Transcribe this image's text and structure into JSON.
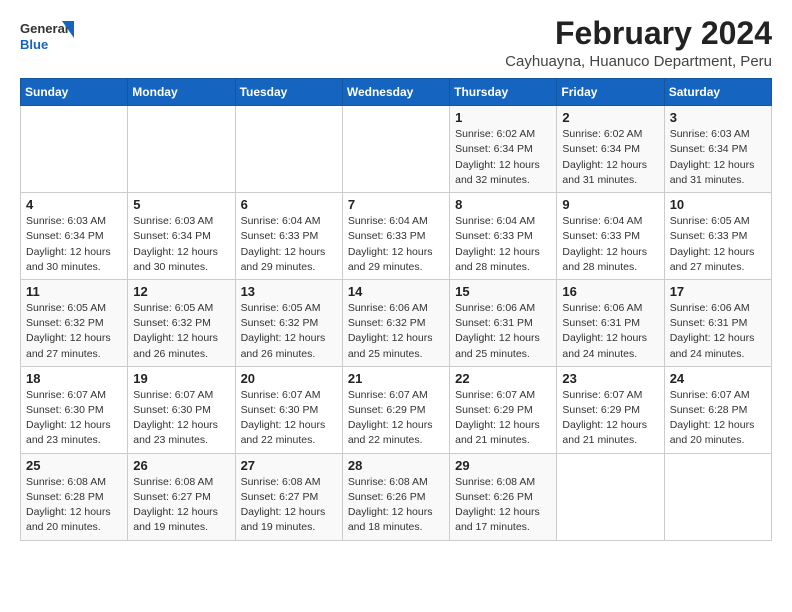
{
  "logo": {
    "general": "General",
    "blue": "Blue"
  },
  "title": "February 2024",
  "subtitle": "Cayhuayna, Huanuco Department, Peru",
  "columns": [
    "Sunday",
    "Monday",
    "Tuesday",
    "Wednesday",
    "Thursday",
    "Friday",
    "Saturday"
  ],
  "weeks": [
    [
      {
        "day": "",
        "detail": ""
      },
      {
        "day": "",
        "detail": ""
      },
      {
        "day": "",
        "detail": ""
      },
      {
        "day": "",
        "detail": ""
      },
      {
        "day": "1",
        "detail": "Sunrise: 6:02 AM\nSunset: 6:34 PM\nDaylight: 12 hours\nand 32 minutes."
      },
      {
        "day": "2",
        "detail": "Sunrise: 6:02 AM\nSunset: 6:34 PM\nDaylight: 12 hours\nand 31 minutes."
      },
      {
        "day": "3",
        "detail": "Sunrise: 6:03 AM\nSunset: 6:34 PM\nDaylight: 12 hours\nand 31 minutes."
      }
    ],
    [
      {
        "day": "4",
        "detail": "Sunrise: 6:03 AM\nSunset: 6:34 PM\nDaylight: 12 hours\nand 30 minutes."
      },
      {
        "day": "5",
        "detail": "Sunrise: 6:03 AM\nSunset: 6:34 PM\nDaylight: 12 hours\nand 30 minutes."
      },
      {
        "day": "6",
        "detail": "Sunrise: 6:04 AM\nSunset: 6:33 PM\nDaylight: 12 hours\nand 29 minutes."
      },
      {
        "day": "7",
        "detail": "Sunrise: 6:04 AM\nSunset: 6:33 PM\nDaylight: 12 hours\nand 29 minutes."
      },
      {
        "day": "8",
        "detail": "Sunrise: 6:04 AM\nSunset: 6:33 PM\nDaylight: 12 hours\nand 28 minutes."
      },
      {
        "day": "9",
        "detail": "Sunrise: 6:04 AM\nSunset: 6:33 PM\nDaylight: 12 hours\nand 28 minutes."
      },
      {
        "day": "10",
        "detail": "Sunrise: 6:05 AM\nSunset: 6:33 PM\nDaylight: 12 hours\nand 27 minutes."
      }
    ],
    [
      {
        "day": "11",
        "detail": "Sunrise: 6:05 AM\nSunset: 6:32 PM\nDaylight: 12 hours\nand 27 minutes."
      },
      {
        "day": "12",
        "detail": "Sunrise: 6:05 AM\nSunset: 6:32 PM\nDaylight: 12 hours\nand 26 minutes."
      },
      {
        "day": "13",
        "detail": "Sunrise: 6:05 AM\nSunset: 6:32 PM\nDaylight: 12 hours\nand 26 minutes."
      },
      {
        "day": "14",
        "detail": "Sunrise: 6:06 AM\nSunset: 6:32 PM\nDaylight: 12 hours\nand 25 minutes."
      },
      {
        "day": "15",
        "detail": "Sunrise: 6:06 AM\nSunset: 6:31 PM\nDaylight: 12 hours\nand 25 minutes."
      },
      {
        "day": "16",
        "detail": "Sunrise: 6:06 AM\nSunset: 6:31 PM\nDaylight: 12 hours\nand 24 minutes."
      },
      {
        "day": "17",
        "detail": "Sunrise: 6:06 AM\nSunset: 6:31 PM\nDaylight: 12 hours\nand 24 minutes."
      }
    ],
    [
      {
        "day": "18",
        "detail": "Sunrise: 6:07 AM\nSunset: 6:30 PM\nDaylight: 12 hours\nand 23 minutes."
      },
      {
        "day": "19",
        "detail": "Sunrise: 6:07 AM\nSunset: 6:30 PM\nDaylight: 12 hours\nand 23 minutes."
      },
      {
        "day": "20",
        "detail": "Sunrise: 6:07 AM\nSunset: 6:30 PM\nDaylight: 12 hours\nand 22 minutes."
      },
      {
        "day": "21",
        "detail": "Sunrise: 6:07 AM\nSunset: 6:29 PM\nDaylight: 12 hours\nand 22 minutes."
      },
      {
        "day": "22",
        "detail": "Sunrise: 6:07 AM\nSunset: 6:29 PM\nDaylight: 12 hours\nand 21 minutes."
      },
      {
        "day": "23",
        "detail": "Sunrise: 6:07 AM\nSunset: 6:29 PM\nDaylight: 12 hours\nand 21 minutes."
      },
      {
        "day": "24",
        "detail": "Sunrise: 6:07 AM\nSunset: 6:28 PM\nDaylight: 12 hours\nand 20 minutes."
      }
    ],
    [
      {
        "day": "25",
        "detail": "Sunrise: 6:08 AM\nSunset: 6:28 PM\nDaylight: 12 hours\nand 20 minutes."
      },
      {
        "day": "26",
        "detail": "Sunrise: 6:08 AM\nSunset: 6:27 PM\nDaylight: 12 hours\nand 19 minutes."
      },
      {
        "day": "27",
        "detail": "Sunrise: 6:08 AM\nSunset: 6:27 PM\nDaylight: 12 hours\nand 19 minutes."
      },
      {
        "day": "28",
        "detail": "Sunrise: 6:08 AM\nSunset: 6:26 PM\nDaylight: 12 hours\nand 18 minutes."
      },
      {
        "day": "29",
        "detail": "Sunrise: 6:08 AM\nSunset: 6:26 PM\nDaylight: 12 hours\nand 17 minutes."
      },
      {
        "day": "",
        "detail": ""
      },
      {
        "day": "",
        "detail": ""
      }
    ]
  ]
}
